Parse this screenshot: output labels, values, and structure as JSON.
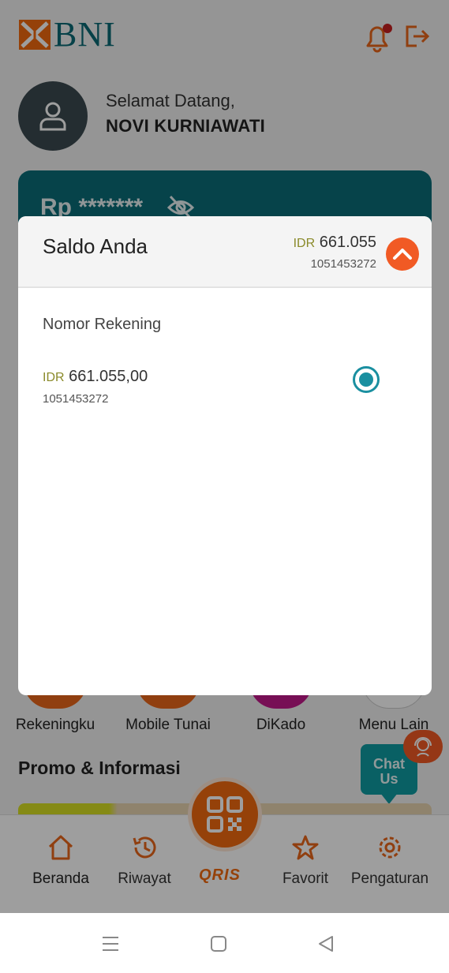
{
  "header": {
    "brand": "BNI"
  },
  "user": {
    "greeting": "Selamat Datang,",
    "name": "NOVI KURNIAWATI"
  },
  "balance_card": {
    "masked_balance": "Rp *******"
  },
  "menu": [
    {
      "label": "Rekeningku",
      "color": "#e8661a"
    },
    {
      "label": "Mobile Tunai",
      "color": "#e8661a"
    },
    {
      "label": "DiKado",
      "color": "#c0198a"
    },
    {
      "label": "Menu Lain",
      "color": "#ffffff"
    }
  ],
  "promo": {
    "title": "Promo & Informasi"
  },
  "chat": {
    "label_line1": "Chat",
    "label_line2": "Us"
  },
  "bottom_nav": {
    "home": "Beranda",
    "history": "Riwayat",
    "qris": "QRIS",
    "favorite": "Favorit",
    "settings": "Pengaturan"
  },
  "sheet": {
    "title": "Saldo Anda",
    "currency": "IDR",
    "header_amount": "661.055",
    "header_account": "1051453272",
    "section_label": "Nomor Rekening",
    "accounts": [
      {
        "currency": "IDR",
        "amount": "661.055,00",
        "number": "1051453272",
        "selected": true
      }
    ]
  },
  "colors": {
    "brand_teal": "#0b6d78",
    "accent_orange": "#f06a0f",
    "radio_teal": "#1a8fa0"
  }
}
